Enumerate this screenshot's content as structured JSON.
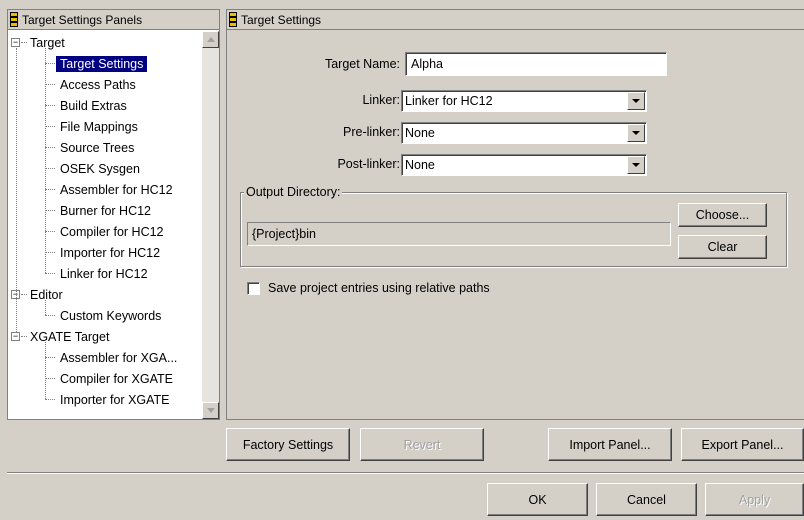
{
  "left_panel": {
    "title": "Target Settings Panels",
    "tree": [
      {
        "label": "Target",
        "level": 0,
        "expander": "−"
      },
      {
        "label": "Target Settings",
        "level": 1,
        "selected": true
      },
      {
        "label": "Access Paths",
        "level": 1
      },
      {
        "label": "Build Extras",
        "level": 1
      },
      {
        "label": "File Mappings",
        "level": 1
      },
      {
        "label": "Source Trees",
        "level": 1
      },
      {
        "label": "OSEK Sysgen",
        "level": 1
      },
      {
        "label": "Assembler for HC12",
        "level": 1
      },
      {
        "label": "Burner for HC12",
        "level": 1
      },
      {
        "label": "Compiler for HC12",
        "level": 1
      },
      {
        "label": "Importer for HC12",
        "level": 1
      },
      {
        "label": "Linker for HC12",
        "level": 1
      },
      {
        "label": "Editor",
        "level": 0,
        "expander": "−"
      },
      {
        "label": "Custom Keywords",
        "level": 1
      },
      {
        "label": "XGATE Target",
        "level": 0,
        "expander": "−"
      },
      {
        "label": "Assembler for XGA...",
        "level": 1
      },
      {
        "label": "Compiler for XGATE",
        "level": 1
      },
      {
        "label": "Importer for XGATE",
        "level": 1
      }
    ]
  },
  "right_panel": {
    "title": "Target Settings",
    "target_name_label": "Target Name:",
    "target_name_value": "Alpha",
    "linker_label": "Linker:",
    "linker_value": "Linker for HC12",
    "prelinker_label": "Pre-linker:",
    "prelinker_value": "None",
    "postlinker_label": "Post-linker:",
    "postlinker_value": "None",
    "output_dir_label": "Output Directory:",
    "output_dir_value": "{Project}bin",
    "choose_label": "Choose...",
    "clear_label": "Clear",
    "relative_paths_label": "Save project entries using relative paths",
    "relative_paths_checked": false
  },
  "panel_buttons": {
    "factory_settings": "Factory Settings",
    "revert": "Revert",
    "import_panel": "Import Panel...",
    "export_panel": "Export Panel..."
  },
  "dialog_buttons": {
    "ok": "OK",
    "cancel": "Cancel",
    "apply": "Apply"
  },
  "colors": {
    "selection": "#000080",
    "face": "#d4d0c8",
    "header_icon": "#e8c000"
  }
}
